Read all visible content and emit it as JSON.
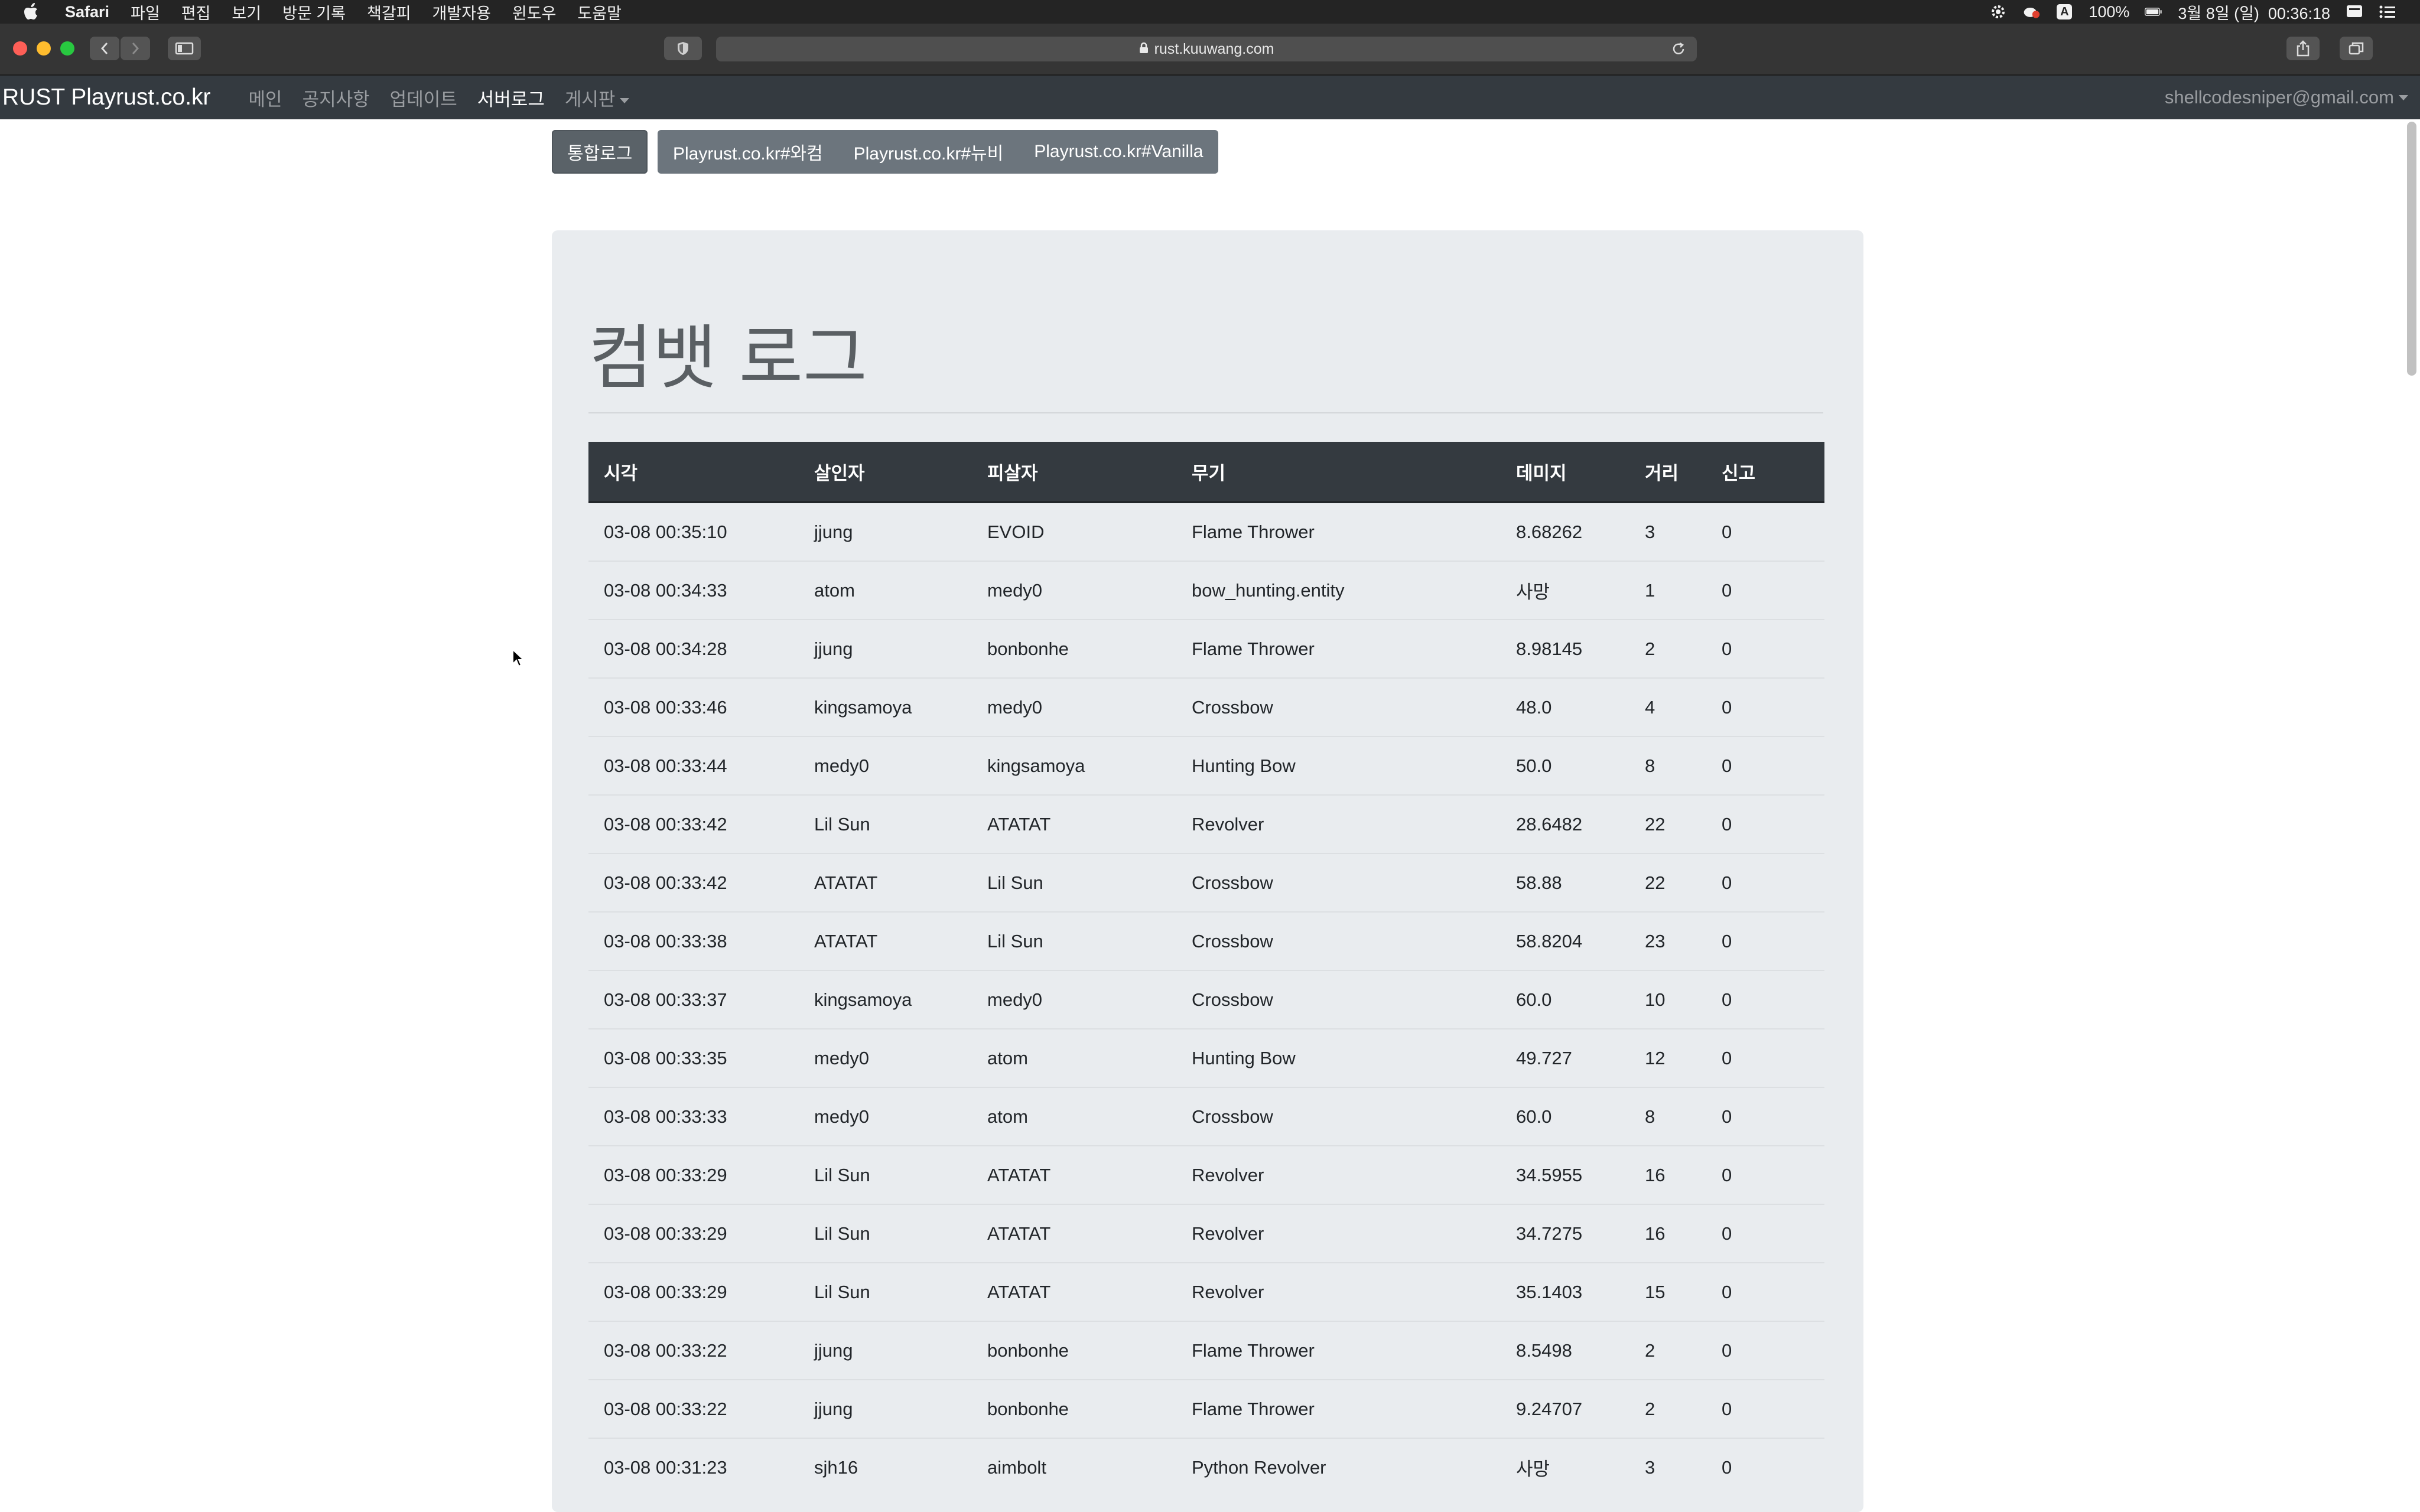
{
  "menubar": {
    "app": "Safari",
    "items": [
      "파일",
      "편집",
      "보기",
      "방문 기록",
      "책갈피",
      "개발자용",
      "윈도우",
      "도움말"
    ],
    "battery": "100%",
    "input_source": "A",
    "clock": "3월 8일 (일)  00:36:18"
  },
  "browser": {
    "url": "rust.kuuwang.com"
  },
  "site": {
    "brand": "RUST Playrust.co.kr",
    "nav": [
      "메인",
      "공지사항",
      "업데이트",
      "서버로그",
      "게시판"
    ],
    "user": "shellcodesniper@gmail.com"
  },
  "log_buttons": {
    "integrated": "통합로그",
    "servers": [
      "Playrust.co.kr#와컴",
      "Playrust.co.kr#뉴비",
      "Playrust.co.kr#Vanilla"
    ]
  },
  "page_title": "컴뱃 로그",
  "table": {
    "headers": [
      "시각",
      "살인자",
      "피살자",
      "무기",
      "데미지",
      "거리",
      "신고"
    ],
    "rows": [
      [
        "03-08 00:35:10",
        "jjung",
        "EVOID",
        "Flame Thrower",
        "8.68262",
        "3",
        "0"
      ],
      [
        "03-08 00:34:33",
        "atom",
        "medy0",
        "bow_hunting.entity",
        "사망",
        "1",
        "0"
      ],
      [
        "03-08 00:34:28",
        "jjung",
        "bonbonhe",
        "Flame Thrower",
        "8.98145",
        "2",
        "0"
      ],
      [
        "03-08 00:33:46",
        "kingsamoya",
        "medy0",
        "Crossbow",
        "48.0",
        "4",
        "0"
      ],
      [
        "03-08 00:33:44",
        "medy0",
        "kingsamoya",
        "Hunting Bow",
        "50.0",
        "8",
        "0"
      ],
      [
        "03-08 00:33:42",
        "Lil Sun",
        "ATATAT",
        "Revolver",
        "28.6482",
        "22",
        "0"
      ],
      [
        "03-08 00:33:42",
        "ATATAT",
        "Lil Sun",
        "Crossbow",
        "58.88",
        "22",
        "0"
      ],
      [
        "03-08 00:33:38",
        "ATATAT",
        "Lil Sun",
        "Crossbow",
        "58.8204",
        "23",
        "0"
      ],
      [
        "03-08 00:33:37",
        "kingsamoya",
        "medy0",
        "Crossbow",
        "60.0",
        "10",
        "0"
      ],
      [
        "03-08 00:33:35",
        "medy0",
        "atom",
        "Hunting Bow",
        "49.727",
        "12",
        "0"
      ],
      [
        "03-08 00:33:33",
        "medy0",
        "atom",
        "Crossbow",
        "60.0",
        "8",
        "0"
      ],
      [
        "03-08 00:33:29",
        "Lil Sun",
        "ATATAT",
        "Revolver",
        "34.5955",
        "16",
        "0"
      ],
      [
        "03-08 00:33:29",
        "Lil Sun",
        "ATATAT",
        "Revolver",
        "34.7275",
        "16",
        "0"
      ],
      [
        "03-08 00:33:29",
        "Lil Sun",
        "ATATAT",
        "Revolver",
        "35.1403",
        "15",
        "0"
      ],
      [
        "03-08 00:33:22",
        "jjung",
        "bonbonhe",
        "Flame Thrower",
        "8.5498",
        "2",
        "0"
      ],
      [
        "03-08 00:33:22",
        "jjung",
        "bonbonhe",
        "Flame Thrower",
        "9.24707",
        "2",
        "0"
      ],
      [
        "03-08 00:31:23",
        "sjh16",
        "aimbolt",
        "Python Revolver",
        "사망",
        "3",
        "0"
      ]
    ]
  }
}
